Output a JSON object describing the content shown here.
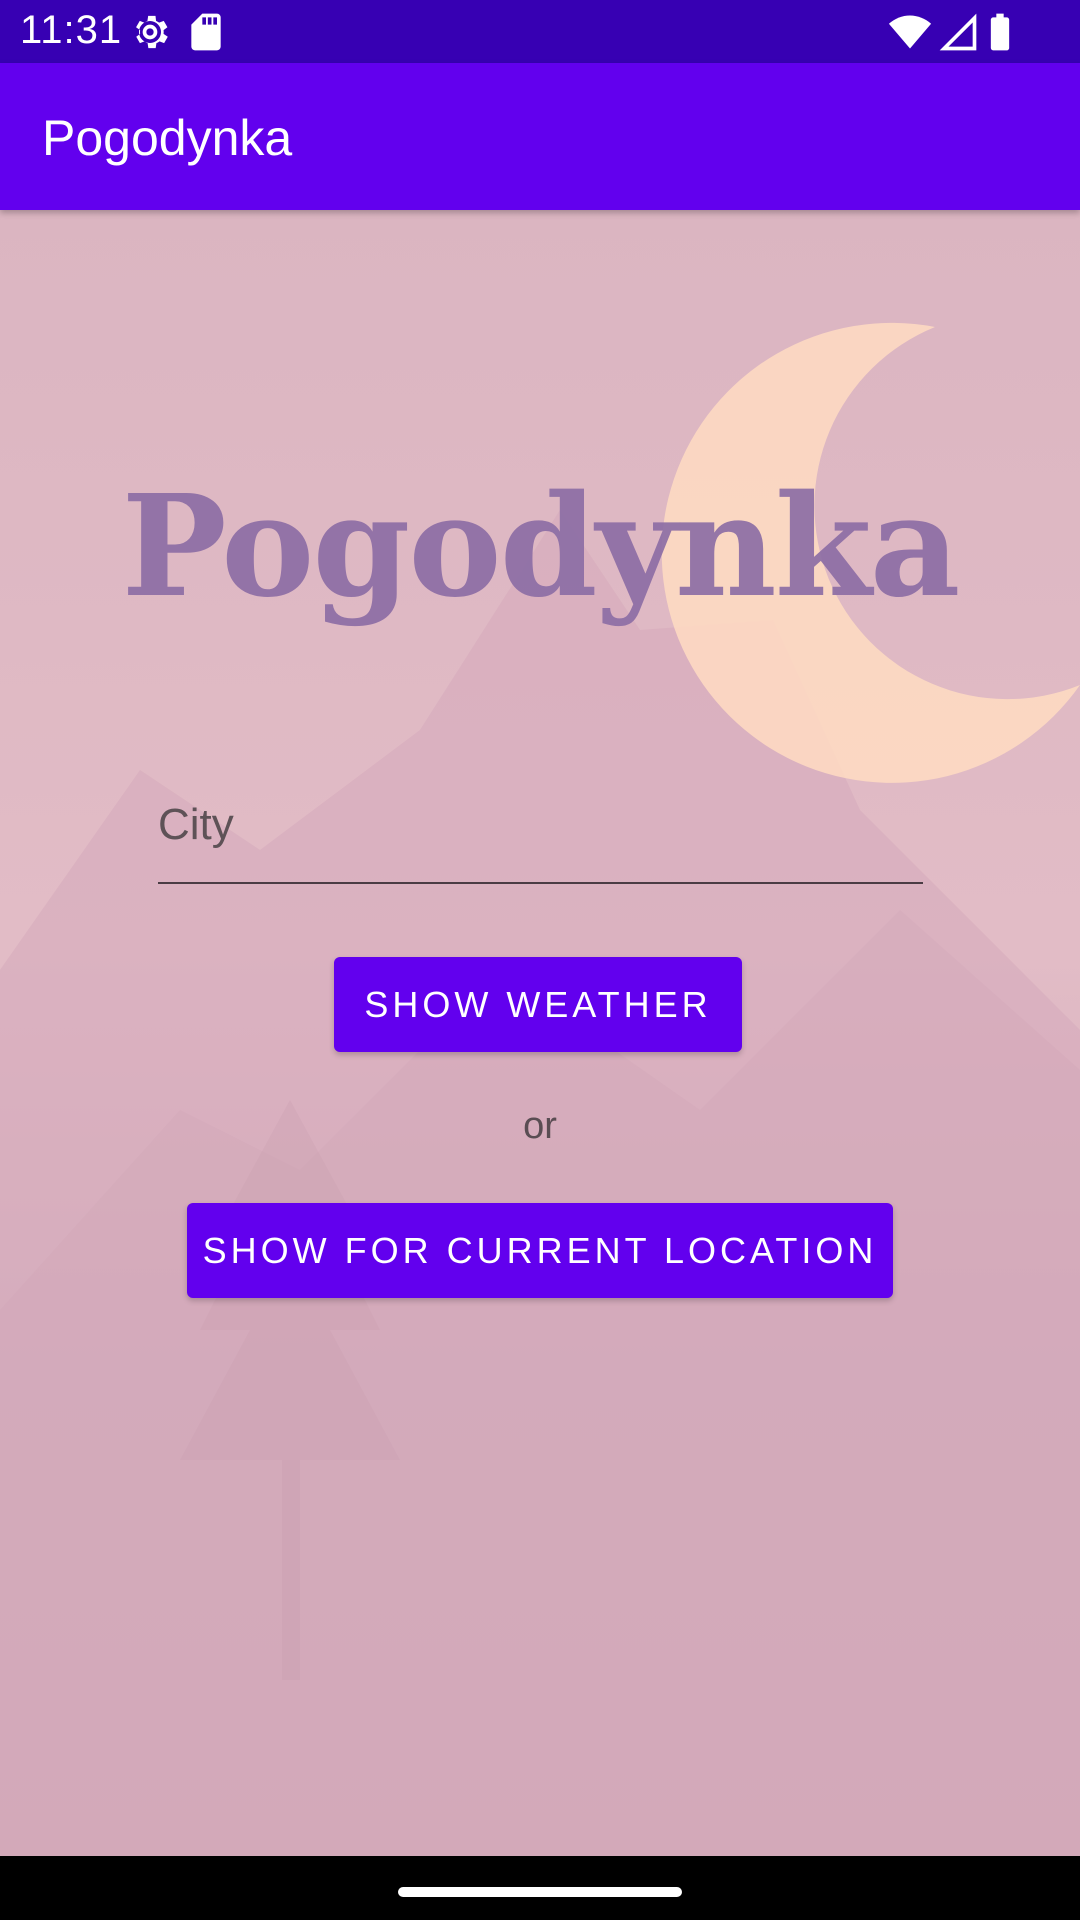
{
  "status_bar": {
    "time": "11:31",
    "icons": [
      "settings-icon",
      "sd-card-icon",
      "wifi-icon",
      "cellular-signal-icon",
      "battery-icon"
    ],
    "background": "#3700b3"
  },
  "app_bar": {
    "title": "Pogodynka",
    "background": "#6200ee"
  },
  "main": {
    "logo_text": "Pogodynka",
    "city_input": {
      "value": "",
      "placeholder": "City"
    },
    "show_weather_label": "SHOW WEATHER",
    "or_label": "or",
    "show_location_label": "SHOW FOR CURRENT LOCATION",
    "accent": "#6200ee"
  },
  "nav_bar": {
    "handle": "home-gesture-handle"
  }
}
